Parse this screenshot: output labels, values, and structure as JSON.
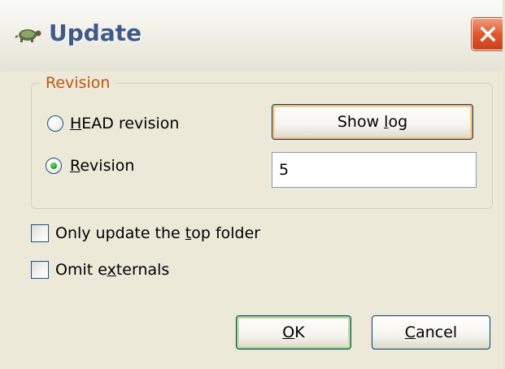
{
  "window": {
    "title": "Update",
    "title_icon": "tortoise-icon",
    "close_icon": "close-x-icon"
  },
  "revision_group": {
    "label": "Revision",
    "options": [
      {
        "label_before": "",
        "mnemonic": "H",
        "label_after": "EAD revision",
        "selected": false
      },
      {
        "label_before": "",
        "mnemonic": "R",
        "label_after": "evision",
        "selected": true
      }
    ],
    "show_log_button": {
      "before": "Show ",
      "mnemonic": "l",
      "after": "og"
    },
    "revision_value": "5"
  },
  "checkboxes": [
    {
      "before": "Only update the ",
      "mnemonic": "t",
      "after": "op folder",
      "checked": false
    },
    {
      "before": "Omit e",
      "mnemonic": "x",
      "after": "ternals",
      "checked": false
    }
  ],
  "buttons": {
    "ok": {
      "before": "",
      "mnemonic": "O",
      "after": "K"
    },
    "cancel": {
      "before": "",
      "mnemonic": "C",
      "after": "ancel"
    }
  },
  "colors": {
    "accent": "#C05414",
    "title_text": "#3F5A8A",
    "close_button": "#E0592D",
    "radio_selected": "#21A121"
  }
}
